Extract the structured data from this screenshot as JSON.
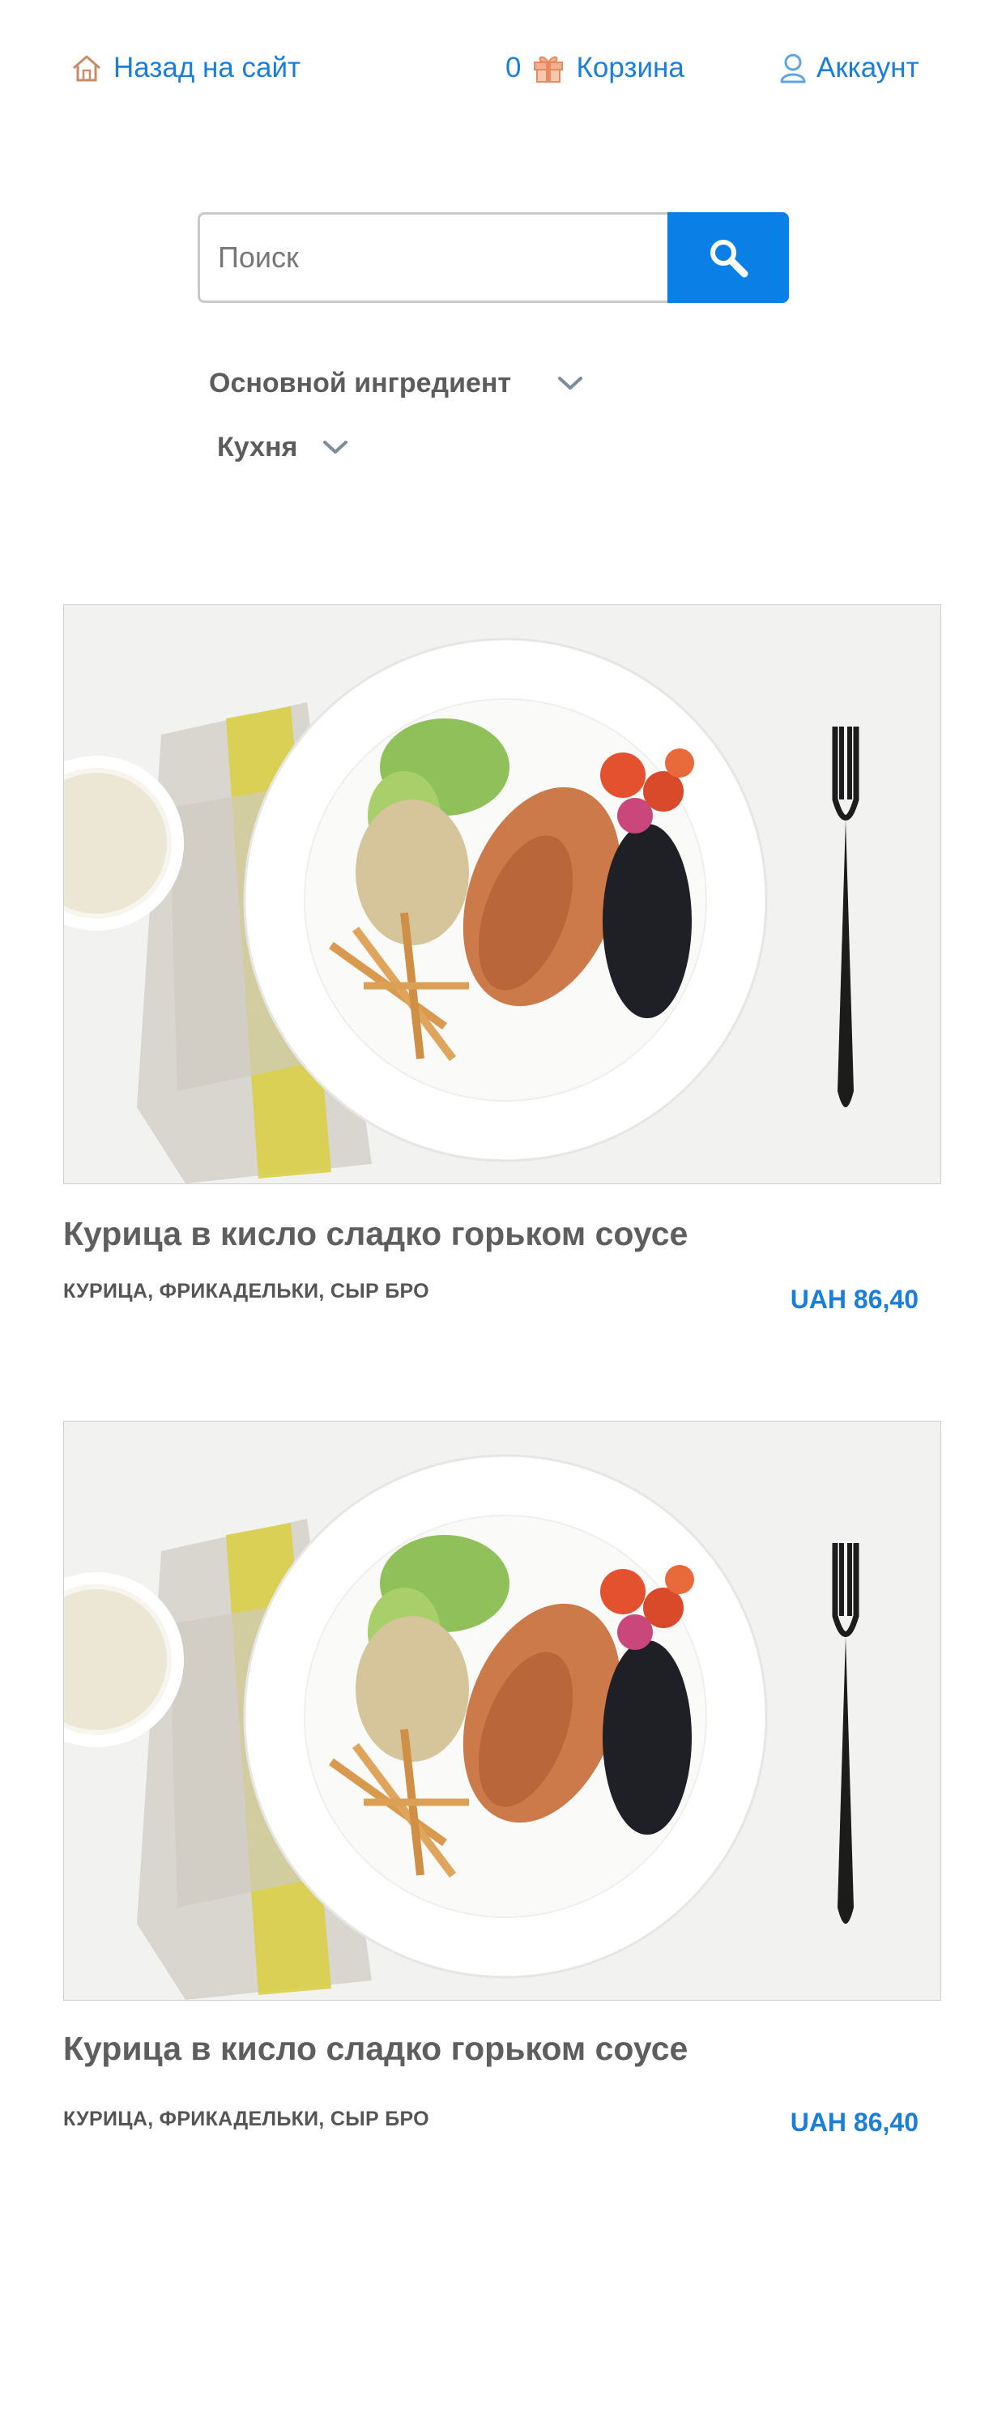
{
  "nav": {
    "home_label": "Назад на сайт",
    "cart_count": "0",
    "cart_label": "Корзина",
    "account_label": "Аккаунт"
  },
  "search": {
    "placeholder": "Поиск"
  },
  "filters": {
    "ingredient_label": "Основной ингредиент",
    "cuisine_label": "Кухня"
  },
  "products": [
    {
      "title": "Курица в кисло сладко горьком соусе",
      "tags": "КУРИЦА, ФРИКАДЕЛЬКИ, СЫР БРО",
      "price": "UAH 86,40"
    },
    {
      "title": "Курица в кисло сладко горьком соусе",
      "tags": "КУРИЦА, ФРИКАДЕЛЬКИ, СЫР БРО",
      "price": "UAH 86,40"
    }
  ],
  "colors": {
    "accent": "#1b7fd9",
    "search_button": "#0a7fe6",
    "text": "#5e5e5e"
  },
  "icons": [
    "home-icon",
    "gift-icon",
    "user-icon",
    "search-icon",
    "chevron-down-icon"
  ]
}
